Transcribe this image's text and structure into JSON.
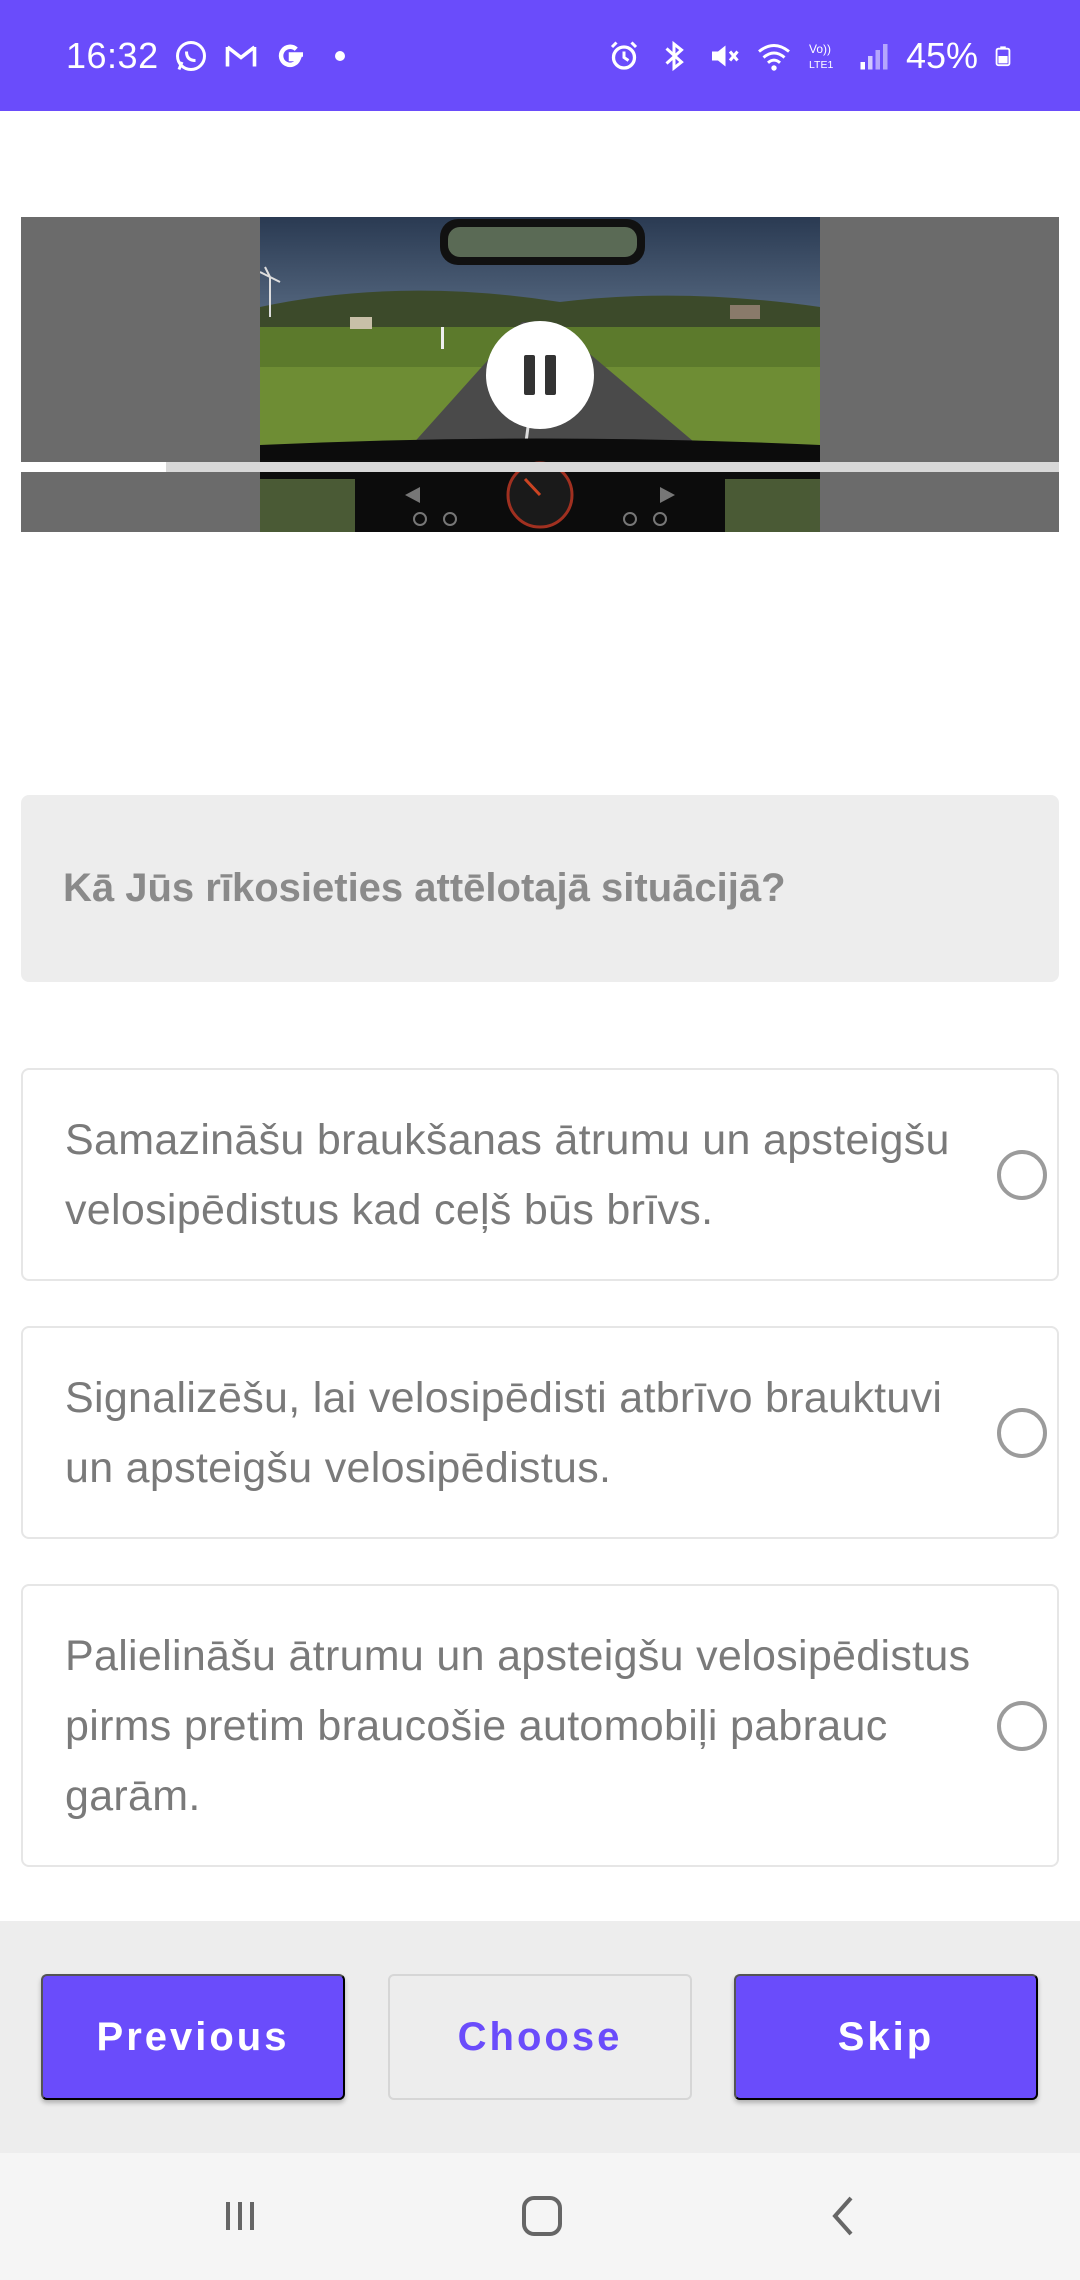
{
  "status_bar": {
    "time": "16:32",
    "battery": "45%",
    "background_color": "#6A4CFB",
    "left_icons": [
      "whatsapp-icon",
      "gmail-icon",
      "google-icon",
      "dot-icon"
    ],
    "right_icons": [
      "alarm-icon",
      "bluetooth-icon",
      "mute-icon",
      "wifi-icon",
      "volte-icon",
      "signal-icon",
      "battery-icon"
    ]
  },
  "video": {
    "state": "playing",
    "progress_fraction": 0.14,
    "control_icon": "pause-icon"
  },
  "question": {
    "text": "Kā Jūs rīkosieties attēlotajā situācijā?"
  },
  "answers": [
    {
      "text": "Samazināšu braukšanas ātrumu un apsteigšu velosipēdistus kad ceļš būs brīvs.",
      "selected": false
    },
    {
      "text": "Signalizēšu, lai velosipēdisti atbrīvo brauktuvi un apsteigšu velosipēdistus.",
      "selected": false
    },
    {
      "text": "Palielināšu ātrumu un apsteigšu velosipēdistus pirms pretim braucošie automobiļi pabrauc garām.",
      "selected": false
    }
  ],
  "actions": {
    "previous_label": "Previous",
    "choose_label": "Choose",
    "skip_label": "Skip",
    "accent_color": "#6A4CFB"
  },
  "nav_bar": {
    "icons": [
      "recent-apps-icon",
      "home-icon",
      "back-icon"
    ]
  }
}
